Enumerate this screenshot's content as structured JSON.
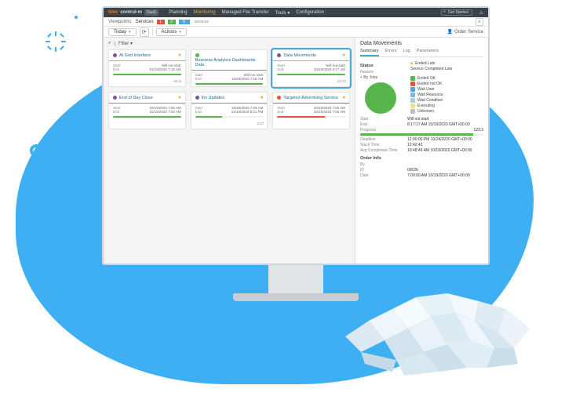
{
  "brand": {
    "logo": "bmc",
    "product": "control-m",
    "saas": "SaaS"
  },
  "topnav": {
    "planning": "Planning",
    "monitoring": "Monitoring",
    "mft": "Managed File Transfer",
    "tools": "Tools ▾",
    "configuration": "Configuration"
  },
  "topright": {
    "get_started": "Get Started"
  },
  "subbar": {
    "viewpoints": "Viewpoints:",
    "services": "Services",
    "count_r": "1",
    "count_g": "2",
    "count_b": "5",
    "services_suffix": "services"
  },
  "toolbar": {
    "today": "Today",
    "actions": "Actions",
    "order_service": "Order Service"
  },
  "filter": {
    "search": "⌕",
    "filter": "Filter ▾"
  },
  "cards": [
    {
      "dot": "#7955a3",
      "title": "AI Grid Interface",
      "hr": "#f3a53a",
      "starred": true,
      "l1k": "Start",
      "l1v": "Will not start",
      "l2k": "End",
      "l2v": "10/19/2020 7:18 AM",
      "prog": 100,
      "progc": "#56b64c",
      "clock": "19:11"
    },
    {
      "dot": "#56b64c",
      "title": "Business Analytics Dashboards Data",
      "hr": "#56b64c",
      "starred": false,
      "l1k": "Start",
      "l1v": "Will not start",
      "l2k": "End",
      "l2v": "10/19/2020 7:18 AM",
      "prog": 100,
      "progc": "#56b64c",
      "clock": ""
    },
    {
      "dot": "#7955a3",
      "title": "Data Movements",
      "hr": "#f3a53a",
      "starred": true,
      "sel": true,
      "l1k": "Start",
      "l1v": "Will not start",
      "l2k": "End",
      "l2v": "10/19/2020 8:17 AM",
      "prog": 100,
      "progc": "#56b64c",
      "clock": "12:13"
    },
    {
      "dot": "#7955a3",
      "title": "End of Day Close",
      "hr": "#56b64c",
      "starred": true,
      "l1k": "Start",
      "l1v": "10/19/2020 7:00 AM",
      "l2k": "End",
      "l2v": "10/19/2020 7:03 AM",
      "prog": 100,
      "progc": "#56b64c",
      "clock": ""
    },
    {
      "dot": "#7955a3",
      "title": "Inv Updates",
      "hr": "#56b64c",
      "starred": true,
      "l1k": "Start",
      "l1v": "10/19/2020 7:05 AM",
      "l2k": "End",
      "l2v": "10/19/2020 8:31 PM",
      "prog": 40,
      "progc": "#56b64c",
      "clock": "4:17"
    },
    {
      "dot": "#e5513d",
      "title": "Targeted Advertising Service",
      "hr": "#e5513d",
      "starred": true,
      "l1k": "Start",
      "l1v": "10/19/2020 7:00 AM",
      "l2k": "End",
      "l2v": "10/19/2020 7:05 AM",
      "prog": 70,
      "progc": "#e5513d",
      "clock": ""
    }
  ],
  "panel": {
    "title": "Data Movements",
    "tabs": {
      "summary": "Summary",
      "errors": "Errors",
      "log": "Log",
      "parameters": "Parameters"
    },
    "status_label": "Status",
    "status_icon_color": "#f3a53a",
    "status_value": "Ended Late",
    "reason_label": "Reason",
    "reason_value": "Service Completed Late",
    "byjobs": "+ By Jobs",
    "legend": [
      {
        "c": "#56b64c",
        "t": "Ended OK"
      },
      {
        "c": "#e5513d",
        "t": "Ended not OK"
      },
      {
        "c": "#4aa7d6",
        "t": "Wait User"
      },
      {
        "c": "#7db8da",
        "t": "Wait Resource"
      },
      {
        "c": "#9bd1e8",
        "t": "Wait Condition"
      },
      {
        "c": "#f3e08a",
        "t": "Executing"
      },
      {
        "c": "#bdbdbd",
        "t": "Unknown"
      }
    ],
    "rows": {
      "start_k": "Start",
      "start_v": "Will not start",
      "end_k": "End",
      "end_v": "8:17:17 AM 10/19/2020\nGMT+00:00",
      "progress_k": "Progress",
      "progress_v": "12/13",
      "deadline_k": "Deadline",
      "deadline_v": "12:00:00 PM 10/24/2020\nGMT+00:00",
      "slack_k": "Slack Time",
      "slack_v": "12:42:43",
      "avg_k": "Avg Completion Time",
      "avg_v": "10:48:49 AM 10/19/2020\nGMT+00:00"
    },
    "order_section": "Order Info",
    "order": {
      "by_k": "By",
      "by_v": "",
      "id_k": "ID",
      "id_v": "0002b",
      "date_k": "Date",
      "date_v": "7:00:00 AM 10/19/2020\nGMT+00:00"
    }
  }
}
